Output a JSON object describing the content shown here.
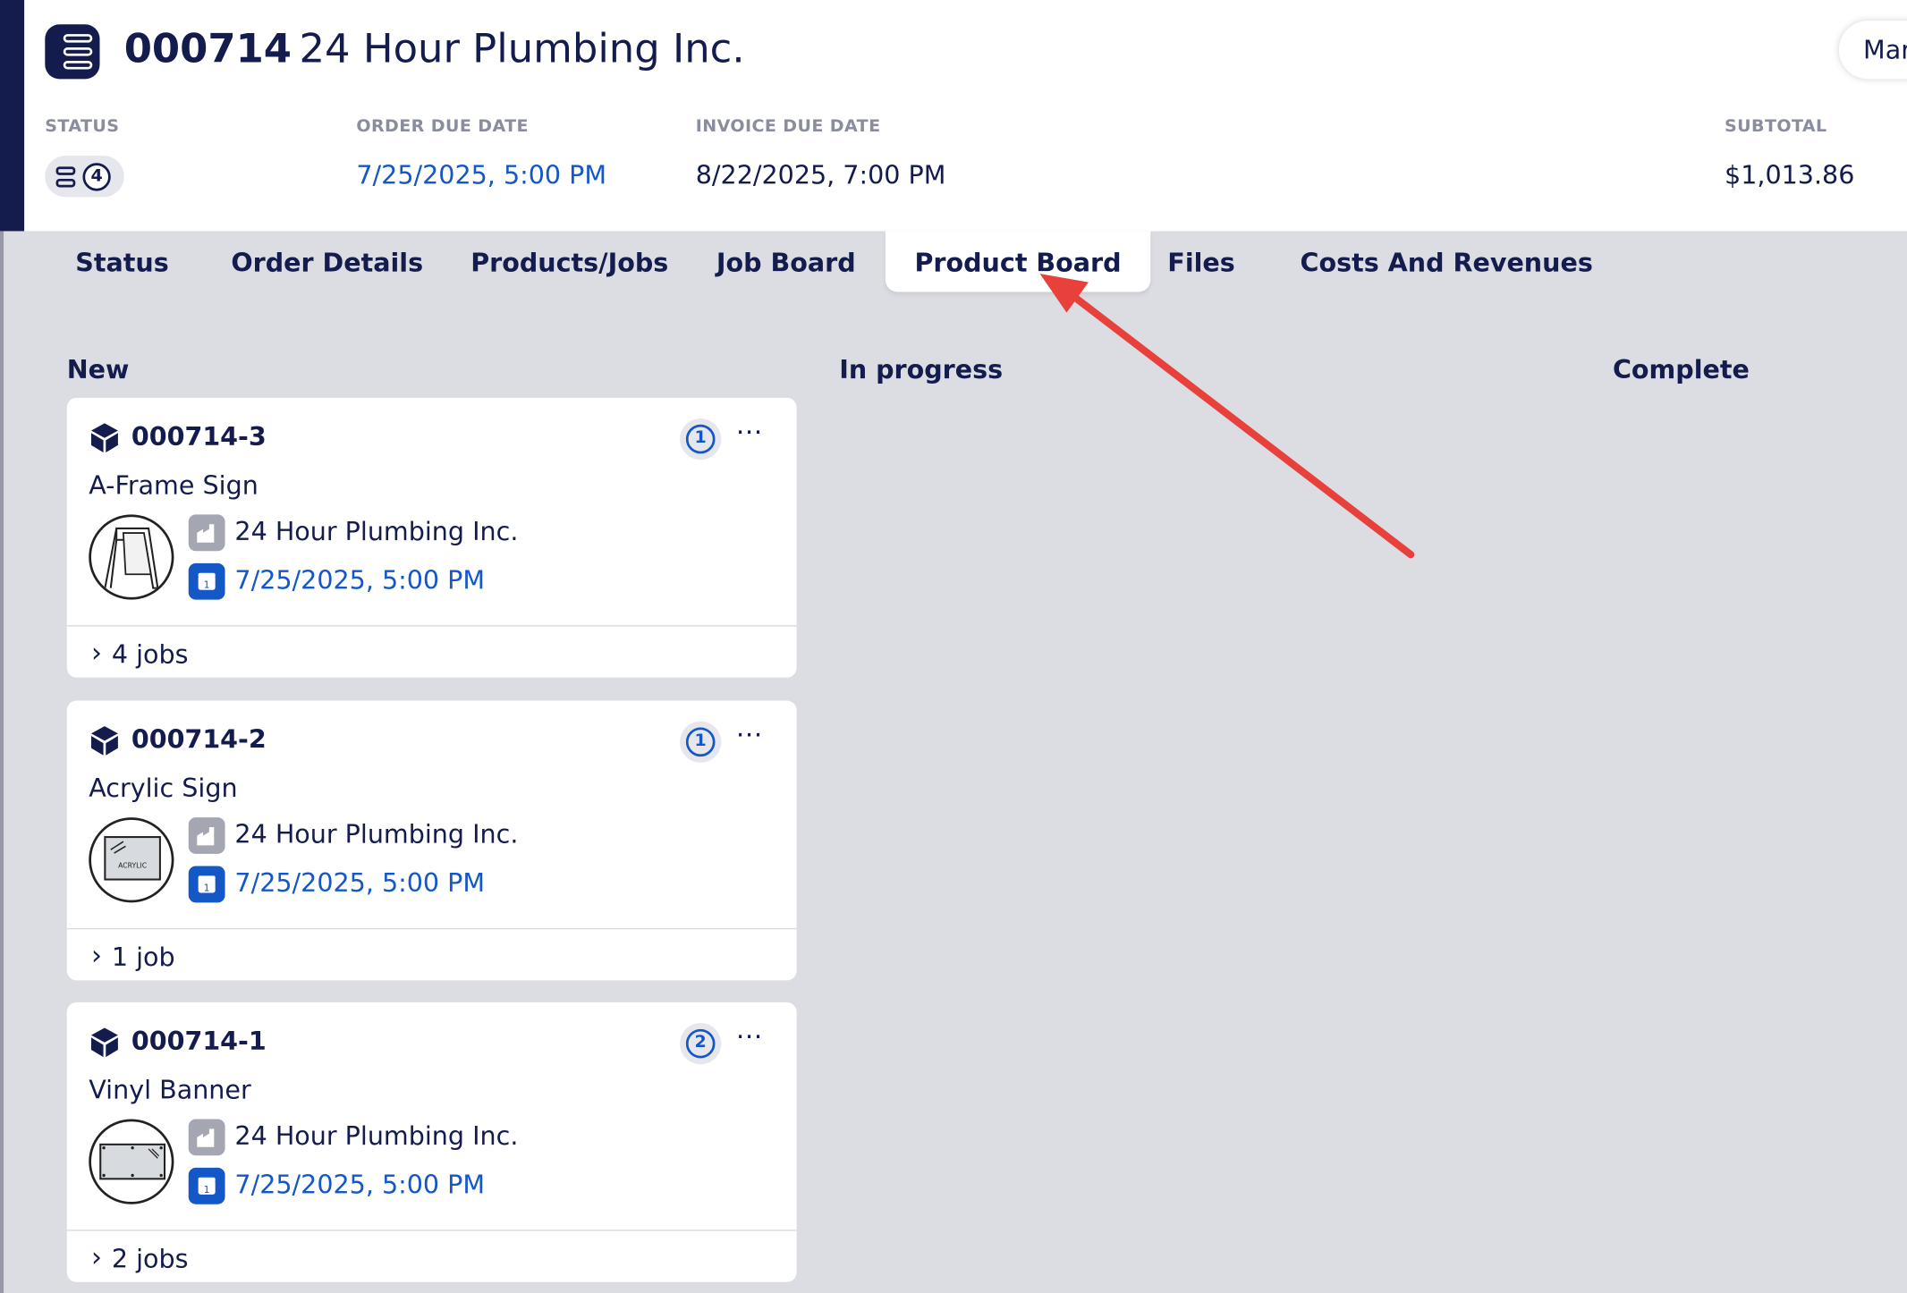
{
  "header": {
    "order_number": "000714",
    "customer": "24 Hour Plumbing Inc.",
    "mark_button_label": "Mar",
    "status_label": "STATUS",
    "status_count": "4",
    "order_due_label": "ORDER DUE DATE",
    "order_due_value": "7/25/2025, 5:00 PM",
    "invoice_due_label": "INVOICE DUE DATE",
    "invoice_due_value": "8/22/2025, 7:00 PM",
    "subtotal_label": "SUBTOTAL",
    "subtotal_value": "$1,013.86"
  },
  "tabs": [
    {
      "label": "Status"
    },
    {
      "label": "Order Details"
    },
    {
      "label": "Products/Jobs"
    },
    {
      "label": "Job Board"
    },
    {
      "label": "Product Board",
      "active": true
    },
    {
      "label": "Files"
    },
    {
      "label": "Costs And Revenues"
    }
  ],
  "board": {
    "columns": [
      {
        "title": "New"
      },
      {
        "title": "In progress"
      },
      {
        "title": "Complete"
      }
    ],
    "cards": [
      {
        "id": "000714-3",
        "name": "A-Frame Sign",
        "qty": "1",
        "company": "24 Hour Plumbing Inc.",
        "date": "7/25/2025, 5:00 PM",
        "jobs": "4 jobs",
        "thumb": "a-frame"
      },
      {
        "id": "000714-2",
        "name": "Acrylic Sign",
        "qty": "1",
        "company": "24 Hour Plumbing Inc.",
        "date": "7/25/2025, 5:00 PM",
        "jobs": "1 job",
        "thumb": "acrylic",
        "thumb_text": "ACRYLIC"
      },
      {
        "id": "000714-1",
        "name": "Vinyl Banner",
        "qty": "2",
        "company": "24 Hour Plumbing Inc.",
        "date": "7/25/2025, 5:00 PM",
        "jobs": "2 jobs",
        "thumb": "banner"
      }
    ]
  },
  "colors": {
    "navy": "#141b4d",
    "link_blue": "#1457c7",
    "board_bg": "#dcdde3",
    "annotation_arrow": "#e8403a"
  },
  "icons": {
    "order": "order-stack-icon",
    "product": "cube-icon",
    "company": "factory-icon",
    "due": "calendar-icon",
    "more": "ellipsis-icon",
    "expand": "chevron-right-icon"
  }
}
